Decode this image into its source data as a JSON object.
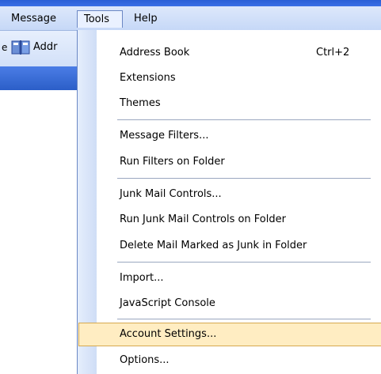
{
  "menubar": {
    "message": "Message",
    "tools": "Tools",
    "help": "Help"
  },
  "toolbar": {
    "left_fragment": "e",
    "address_book_label": "Addr"
  },
  "tools_menu": {
    "items": [
      {
        "label": "Address Book",
        "shortcut": "Ctrl+2"
      },
      {
        "label": "Extensions"
      },
      {
        "label": "Themes"
      },
      {
        "label": "Message Filters..."
      },
      {
        "label": "Run Filters on Folder"
      },
      {
        "label": "Junk Mail Controls..."
      },
      {
        "label": "Run Junk Mail Controls on Folder"
      },
      {
        "label": "Delete Mail Marked as Junk in Folder"
      },
      {
        "label": "Import..."
      },
      {
        "label": "JavaScript Console"
      },
      {
        "label": "Account Settings...",
        "selected": true
      },
      {
        "label": "Options..."
      }
    ]
  },
  "colors": {
    "highlight": "#ffedc2",
    "highlight_border": "#d6a94f",
    "menubar": "#c6d8f7"
  }
}
